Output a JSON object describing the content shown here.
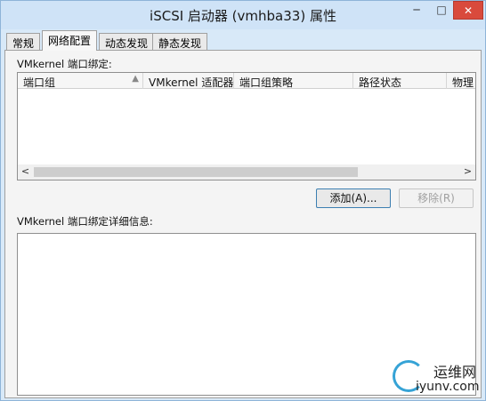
{
  "window": {
    "title": "iSCSI 启动器 (vmhba33) 属性",
    "controls": {
      "minimize": "─",
      "maximize": "□",
      "close": "✕"
    }
  },
  "tabs": [
    {
      "label": "常规",
      "active": false
    },
    {
      "label": "网络配置",
      "active": true
    },
    {
      "label": "动态发现",
      "active": false
    },
    {
      "label": "静态发现",
      "active": false
    }
  ],
  "port_binding": {
    "section_label": "VMkernel 端口绑定:",
    "columns": [
      "端口组",
      "VMkernel 适配器",
      "端口组策略",
      "路径状态",
      "物理"
    ],
    "sort_indicator": "▲",
    "rows": [],
    "scroll_left": "<",
    "scroll_right": ">"
  },
  "buttons": {
    "add": "添加(A)...",
    "remove": "移除(R)"
  },
  "details": {
    "section_label": "VMkernel 端口绑定详细信息:"
  },
  "watermark": {
    "name": "运维网",
    "url": "iyunv.com"
  },
  "colors": {
    "title_bar": "#cfe3f7",
    "close_button": "#d94a3c",
    "logo_accent": "#36a3d6"
  }
}
